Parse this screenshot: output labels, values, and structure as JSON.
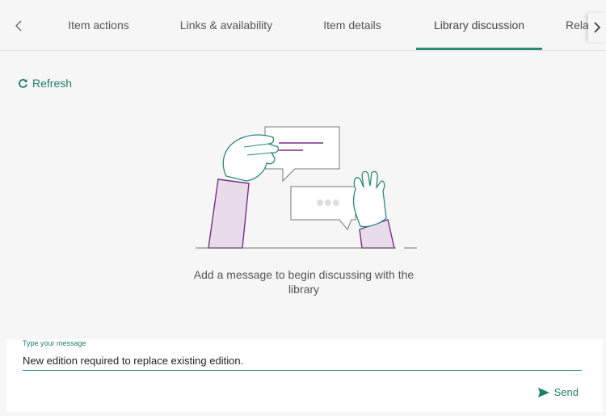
{
  "tabs": [
    {
      "label": "Item actions",
      "active": false
    },
    {
      "label": "Links & availability",
      "active": false
    },
    {
      "label": "Item details",
      "active": false
    },
    {
      "label": "Library discussion",
      "active": true
    },
    {
      "label": "Rela",
      "active": false
    }
  ],
  "refresh": {
    "label": "Refresh",
    "icon": "refresh-icon"
  },
  "empty_state": {
    "message": "Add a message to begin discussing with the library"
  },
  "composer": {
    "label": "Type your message",
    "value": "New edition required to replace existing edition."
  },
  "send": {
    "label": "Send",
    "icon": "send-icon"
  },
  "colors": {
    "accent": "#2a8a78",
    "illustration_purple": "#7a2a8a",
    "illustration_fill": "#e8dcea"
  }
}
